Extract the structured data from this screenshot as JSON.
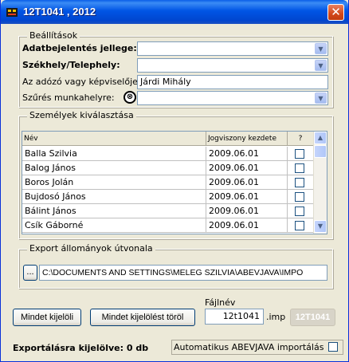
{
  "window": {
    "title": "12T1041 , 2012",
    "close_glyph": "✕"
  },
  "settings": {
    "legend": "Beállítások",
    "adatbejelentes_label": "Adatbejelentés jellege:",
    "adatbejelentes_value": "",
    "szekhely_label": "Székhely/Telephely:",
    "szekhely_value": "",
    "kepviselo_label": "Az adózó vagy képviselője:",
    "kepviselo_value": "Járdi Mihály",
    "szures_label": "Szűrés munkahelyre:",
    "szures_value": "",
    "clear_glyph": "⊗"
  },
  "persons": {
    "legend": "Személyek kiválasztása",
    "columns": [
      "Név",
      "Jogviszony kezdete",
      "?"
    ],
    "rows": [
      {
        "name": "Balla Szilvia",
        "date": "2009.06.01",
        "checked": false
      },
      {
        "name": "Balog János",
        "date": "2009.06.01",
        "checked": false
      },
      {
        "name": "Boros Jolán",
        "date": "2009.06.01",
        "checked": false
      },
      {
        "name": "Bujdosó János",
        "date": "2009.06.01",
        "checked": false
      },
      {
        "name": "Bálint János",
        "date": "2009.06.01",
        "checked": false
      },
      {
        "name": "Csík Gáborné",
        "date": "2009.06.01",
        "checked": false
      }
    ]
  },
  "export": {
    "legend": "Export állományok útvonala",
    "browse_label": "...",
    "path": "C:\\DOCUMENTS AND SETTINGS\\MELEG SZILVIA\\ABEVJAVA\\IMPO"
  },
  "actions": {
    "select_all": "Mindet kijelöli",
    "deselect_all": "Mindet kijelölést töröl",
    "filename_label": "Fájlnév",
    "filename_value": "12t1041",
    "extension": ".imp",
    "form_code": "12T1041"
  },
  "status": {
    "selected_count": "Exportálásra kijelölve: 0 db",
    "auto_import_label": "Automatikus ABEVJAVA importálás",
    "auto_import_checked": false
  },
  "colors": {
    "titlebar": "#0055e5",
    "window_bg": "#ece9d8",
    "field_border": "#7f9db9"
  }
}
